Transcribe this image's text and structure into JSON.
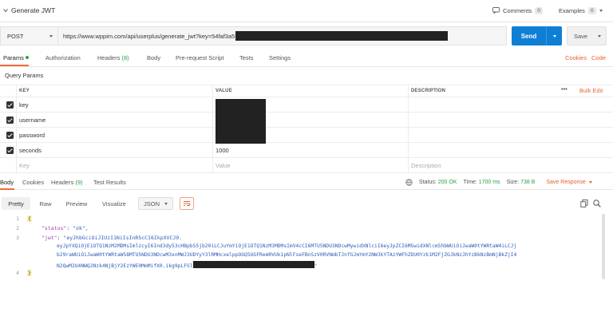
{
  "title": "Generate JWT",
  "header": {
    "comments_label": "Comments",
    "comments_count": "0",
    "examples_label": "Examples",
    "examples_count": "0"
  },
  "request": {
    "method": "POST",
    "url": "https://www.wppim.com/api/userplus/generate_jwt?key=54faf3a5",
    "send_label": "Send",
    "save_label": "Save"
  },
  "request_tabs": {
    "params": "Params",
    "authorization": "Authorization",
    "headers": "Headers",
    "headers_count": "(8)",
    "body": "Body",
    "prerequest": "Pre-request Script",
    "tests": "Tests",
    "settings": "Settings",
    "cookies": "Cookies",
    "code": "Code"
  },
  "query_params": {
    "title": "Query Params",
    "columns": {
      "key": "KEY",
      "value": "VALUE",
      "description": "DESCRIPTION"
    },
    "more": "•••",
    "bulk_edit": "Bulk Edit",
    "rows": [
      {
        "key": "key",
        "value": ""
      },
      {
        "key": "username",
        "value": ""
      },
      {
        "key": "password",
        "value": ""
      },
      {
        "key": "seconds",
        "value": "1000"
      }
    ],
    "placeholder_key": "Key",
    "placeholder_value": "Value",
    "placeholder_description": "Description"
  },
  "response_tabs": {
    "body": "Body",
    "cookies": "Cookies",
    "headers": "Headers",
    "headers_count": "(9)",
    "test_results": "Test Results"
  },
  "response_status": {
    "status_label": "Status:",
    "status_value": "200 OK",
    "time_label": "Time:",
    "time_value": "1700 ms",
    "size_label": "Size:",
    "size_value": "738 B",
    "save_response": "Save Response"
  },
  "response_toolbar": {
    "pretty": "Pretty",
    "raw": "Raw",
    "preview": "Preview",
    "visualize": "Visualize",
    "format": "JSON"
  },
  "response_body": {
    "line_numbers": [
      "1",
      "2",
      "3",
      "4"
    ],
    "open_brace": "{",
    "close_brace": "}",
    "status_key": "\"status\"",
    "status_value": "\"ok\",",
    "jwt_key": "\"jwt\"",
    "jwt_line1": "\"eyJhbGciOiJIUzI1NiIsInR5cCI6IkpXVCJ9.",
    "jwt_line2": "eyJpYXQiOjE1OTQ1NzM2MDMsImlzcyI6Ind3dy53cHBpbS5jb20iLCJuYmYiOjE1OTQ1NzM3MDMsImV4cCI6MTU5NDU3NDcwMywidXNlciI6eyJpZCI6MSwidXNlcm5hbWUiOiJwaW0tYWRtaW4iLCJj",
    "jwt_line3": "b29raWUiOiJwaW0tYWRtaW58MTU5NDU3NDcwM3xnMWJ3UDYyY3lRMHcxelppOGQ5UGFRemRVUk1pNlFseFBnSzV0RVNmbTJnfGJmYmY2NWJkYTAzYWFhZDU0Yzk1M2FjZGJkNzJhYzBkNzBmNjBkZjI4",
    "jwt_line4_start": "N2QwM2U4NWQ2Nzk4NjBjY2EzYWE0MmMifX0.ikg9pLFSl",
    "jwt_line4_end": "\""
  },
  "colors": {
    "accent": "#f26b3a",
    "send": "#0f7fd6",
    "status_ok": "#2e9e44",
    "json_key": "#9a3fa8",
    "json_string": "#2b5cb8"
  }
}
